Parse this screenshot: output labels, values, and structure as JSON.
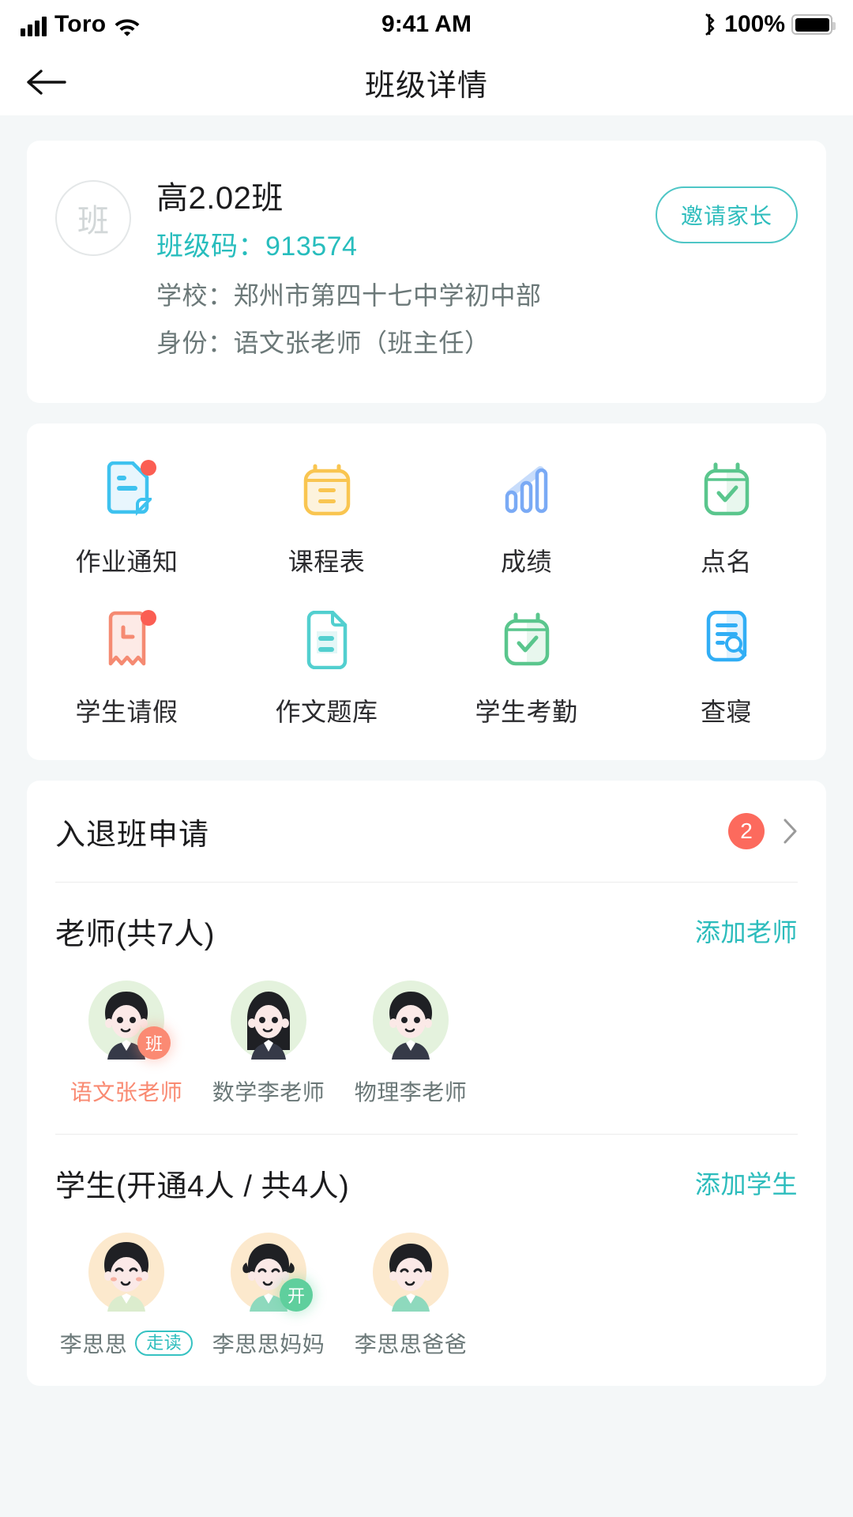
{
  "statusbar": {
    "carrier": "Toro",
    "time": "9:41 AM",
    "battery_percent": "100%",
    "wifi_icon": "wifi-icon",
    "bluetooth_icon": "bluetooth-icon",
    "signal_icon": "signal-bars-icon",
    "battery_icon": "battery-full-icon"
  },
  "navbar": {
    "title": "班级详情",
    "back_icon": "arrow-left-icon"
  },
  "class_card": {
    "avatar_char": "班",
    "name": "高2.02班",
    "code_label": "班级码：",
    "code_value": "913574",
    "school_label": "学校：",
    "school_value": "郑州市第四十七中学初中部",
    "role_label": "身份：",
    "role_value": "语文张老师（班主任）",
    "invite_button": "邀请家长",
    "accent_color": "#27bdbd"
  },
  "features": [
    {
      "label": "作业通知",
      "icon": "homework-notice-icon",
      "color": "#3ec2ef",
      "badge": true
    },
    {
      "label": "课程表",
      "icon": "timetable-icon",
      "color": "#f9c550",
      "badge": false
    },
    {
      "label": "成绩",
      "icon": "grades-bars-icon",
      "color": "#7aaaf5",
      "badge": false
    },
    {
      "label": "点名",
      "icon": "roll-call-icon",
      "color": "#5ac68d",
      "badge": false
    },
    {
      "label": "学生请假",
      "icon": "student-leave-icon",
      "color": "#f58a72",
      "badge": true
    },
    {
      "label": "作文题库",
      "icon": "essay-bank-icon",
      "color": "#52cfcf",
      "badge": false
    },
    {
      "label": "学生考勤",
      "icon": "attendance-icon",
      "color": "#5ac68d",
      "badge": false
    },
    {
      "label": "查寝",
      "icon": "dorm-check-icon",
      "color": "#31aef5",
      "badge": false
    }
  ],
  "apply_row": {
    "title": "入退班申请",
    "badge": "2",
    "badge_color": "#fc6a5d",
    "chevron_icon": "chevron-right-icon"
  },
  "teachers_section": {
    "title": "老师(共7人)",
    "action": "添加老师",
    "count_total": 7,
    "people": [
      {
        "name": "语文张老师",
        "avatar": "avatar-male-teacher",
        "highlight": true,
        "badge": "班",
        "badge_color": "#fb8a73",
        "tag": null
      },
      {
        "name": "数学李老师",
        "avatar": "avatar-female-teacher",
        "highlight": false,
        "badge": null,
        "badge_color": null,
        "tag": null
      },
      {
        "name": "物理李老师",
        "avatar": "avatar-male-teacher",
        "highlight": false,
        "badge": null,
        "badge_color": null,
        "tag": null
      }
    ]
  },
  "students_section": {
    "title": "学生(开通4人 / 共4人)",
    "action": "添加学生",
    "count_activated": 4,
    "count_total": 4,
    "people": [
      {
        "name": "李思思",
        "avatar": "avatar-boy-student",
        "highlight": false,
        "badge": null,
        "badge_color": null,
        "tag": "走读"
      },
      {
        "name": "李思思妈妈",
        "avatar": "avatar-mother",
        "highlight": false,
        "badge": "开",
        "badge_color": "#5fcf9d",
        "tag": null
      },
      {
        "name": "李思思爸爸",
        "avatar": "avatar-father",
        "highlight": false,
        "badge": null,
        "badge_color": null,
        "tag": null
      }
    ]
  }
}
